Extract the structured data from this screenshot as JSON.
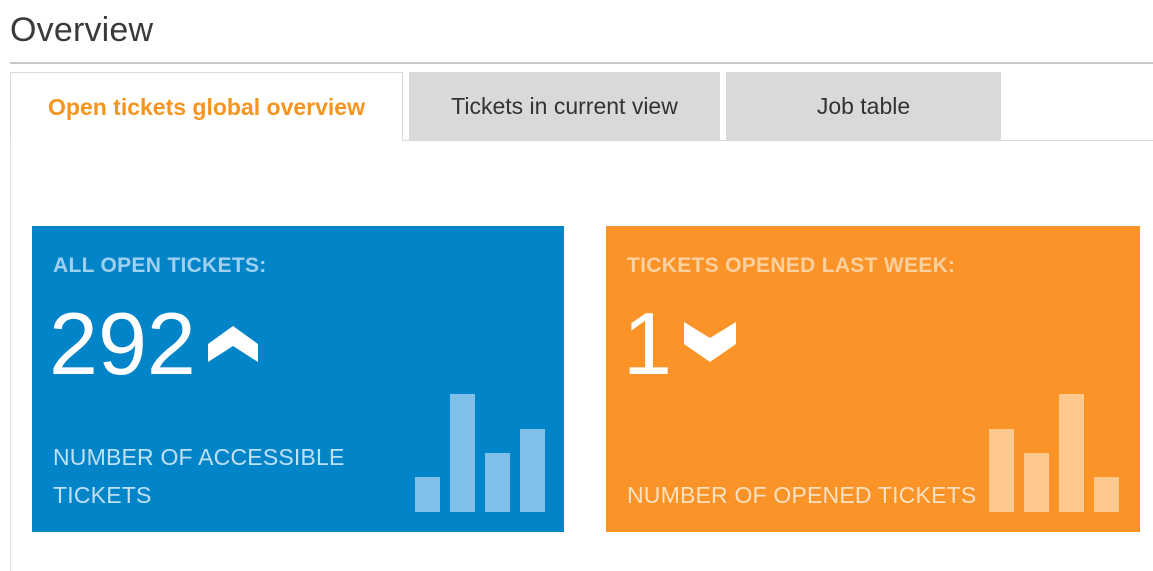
{
  "page": {
    "title": "Overview"
  },
  "tabs": [
    {
      "label": "Open tickets global overview",
      "active": true
    },
    {
      "label": "Tickets in current view",
      "active": false
    },
    {
      "label": "Job table",
      "active": false
    }
  ],
  "colors": {
    "active_tab_text": "#f7941d",
    "inactive_tab_bg": "#d9d9d9",
    "card_blue": "#0184c8",
    "card_orange": "#fa9428"
  },
  "cards": [
    {
      "heading": "ALL OPEN TICKETS:",
      "value": "292",
      "trend_icon": "chevron-up-icon",
      "footer": "NUMBER OF ACCESSIBLE TICKETS",
      "sparkline_relative_values": [
        0.3,
        1.0,
        0.5,
        0.7
      ]
    },
    {
      "heading": "TICKETS OPENED LAST WEEK:",
      "value": "1",
      "trend_icon": "chevron-down-icon",
      "footer": "NUMBER OF OPENED TICKETS",
      "sparkline_relative_values": [
        0.7,
        0.5,
        1.0,
        0.3
      ]
    }
  ]
}
